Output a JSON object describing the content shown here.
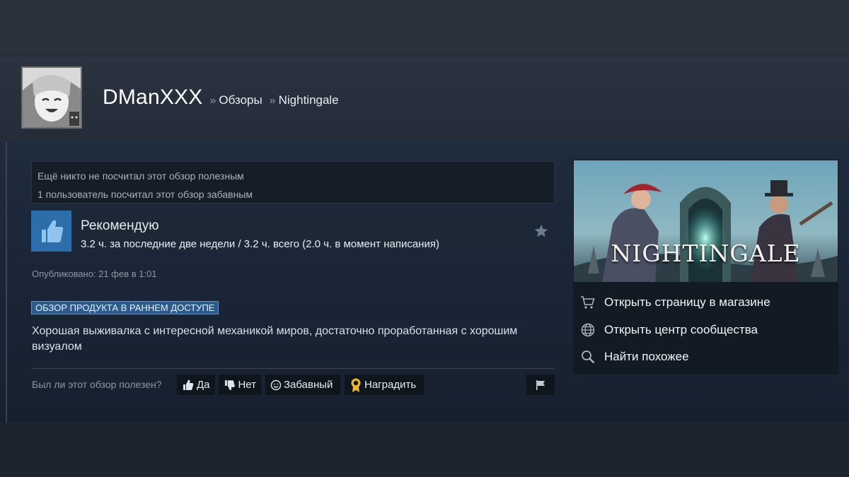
{
  "header": {
    "username": "DManXXX",
    "separator": "»",
    "breadcrumb": [
      "Обзоры",
      "Nightingale"
    ]
  },
  "votes": {
    "helpful_text": "Ещё никто не посчитал этот обзор полезным",
    "funny_text": "1 пользователь посчитал этот обзор забавным"
  },
  "recommendation": {
    "title": "Рекомендую",
    "hours": "3.2 ч. за последние две недели / 3.2 ч. всего (2.0 ч. в момент написания)",
    "icon": "thumbs-up-icon"
  },
  "review": {
    "posted": "Опубликовано: 21 фев в 1:01",
    "early_access_badge": "ОБЗОР ПРОДУКТА В РАННЕМ ДОСТУПЕ",
    "text": "Хорошая выживалка с интересной механикой миров, достаточно проработанная с хорошим визуалом"
  },
  "feedback": {
    "question": "Был ли этот обзор полезен?",
    "yes": "Да",
    "no": "Нет",
    "funny": "Забавный",
    "award": "Наградить"
  },
  "game": {
    "logo": "NIGHTINGALE",
    "links": [
      {
        "label": "Открыть страницу в магазине",
        "icon": "cart-icon"
      },
      {
        "label": "Открыть центр сообщества",
        "icon": "globe-icon"
      },
      {
        "label": "Найти похожее",
        "icon": "search-icon"
      }
    ]
  },
  "colors": {
    "accent_blue": "#2c6ea9",
    "badge_bg": "#2d5a8c",
    "award_gold": "#e8b82a"
  }
}
